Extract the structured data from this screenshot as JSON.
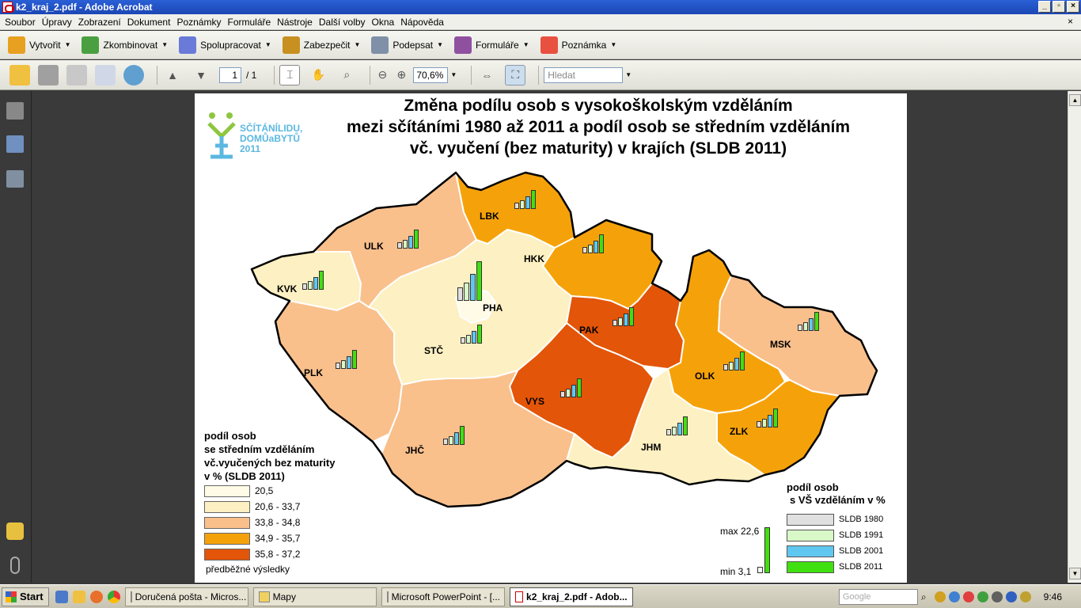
{
  "window": {
    "title": "k2_kraj_2.pdf - Adobe Acrobat",
    "controls": [
      "_",
      "▫",
      "×"
    ]
  },
  "menu": [
    "Soubor",
    "Úpravy",
    "Zobrazení",
    "Dokument",
    "Poznámky",
    "Formuláře",
    "Nástroje",
    "Další volby",
    "Okna",
    "Nápověda"
  ],
  "menu_close": "×",
  "toolbar1": [
    {
      "label": "Vytvořit",
      "icon": "create-icon",
      "color": "#e8a020"
    },
    {
      "label": "Zkombinovat",
      "icon": "combine-icon",
      "color": "#4aa040"
    },
    {
      "label": "Spolupracovat",
      "icon": "collaborate-icon",
      "color": "#6a7ad8"
    },
    {
      "label": "Zabezpečit",
      "icon": "lock-icon",
      "color": "#c89020"
    },
    {
      "label": "Podepsat",
      "icon": "pen-icon",
      "color": "#8090a8"
    },
    {
      "label": "Formuláře",
      "icon": "forms-icon",
      "color": "#9050a0"
    },
    {
      "label": "Poznámka",
      "icon": "comment-icon",
      "color": "#e85040"
    }
  ],
  "toolbar2": {
    "page_current": "1",
    "page_total": "/ 1",
    "zoom": "70,6%",
    "search_placeholder": "Hledat"
  },
  "map": {
    "title_lines": [
      "Změna podílu osob s vysokoškolským vzděláním",
      "mezi sčítáními 1980 až 2011 a podíl osob se středním vzděláním",
      "vč. vyučení (bez maturity) v krajích (SLDB 2011)"
    ],
    "logo_lines": [
      "SČÍTÁNÍLIDU,",
      "DOMŮaBYTŮ",
      "2011"
    ],
    "regions": [
      "LBK",
      "ULK",
      "KVK",
      "PHA",
      "HKK",
      "STČ",
      "PAK",
      "PLK",
      "MSK",
      "OLK",
      "VYS",
      "JHČ",
      "ZLK",
      "JHM"
    ],
    "legend_left": {
      "title_lines": [
        "podíl osob",
        "se středním vzděláním",
        "vč.vyučených bez maturity",
        "v % (SLDB 2011)"
      ],
      "classes": [
        {
          "label": "20,5",
          "color": "#fffbe6"
        },
        {
          "label": "20,6 - 33,7",
          "color": "#fdf0c2"
        },
        {
          "label": "33,8 - 34,8",
          "color": "#f9c08c"
        },
        {
          "label": "34,9 - 35,7",
          "color": "#f5a20a"
        },
        {
          "label": "35,8 - 37,2",
          "color": "#e35508"
        }
      ],
      "note": "předběžné výsledky"
    },
    "legend_right": {
      "title_lines": [
        "podíl osob",
        "s VŠ vzděláním v %"
      ],
      "series": [
        {
          "label": "SLDB 1980",
          "color": "#e0e0e0"
        },
        {
          "label": "SLDB 1991",
          "color": "#d8f8c8"
        },
        {
          "label": "SLDB 2001",
          "color": "#60c8f0"
        },
        {
          "label": "SLDB 2011",
          "color": "#40e010"
        }
      ],
      "max_label": "max 22,6",
      "min_label": "min 3,1"
    }
  },
  "taskbar": {
    "start": "Start",
    "tasks": [
      "Doručená pošta - Micros...",
      "Mapy",
      "Microsoft PowerPoint - [...",
      "k2_kraj_2.pdf - Adob..."
    ],
    "search_placeholder": "Google",
    "clock": "9:46"
  }
}
